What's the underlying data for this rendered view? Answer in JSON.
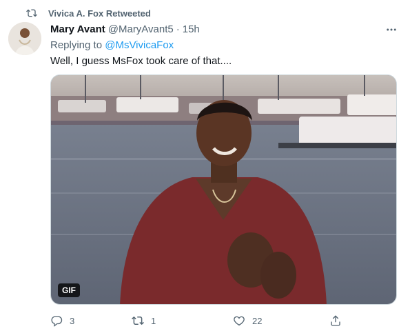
{
  "retweet_label": "Vivica A. Fox Retweeted",
  "tweet": {
    "display_name": "Mary Avant",
    "handle": "@MaryAvant5",
    "separator": "·",
    "time": "15h",
    "replying_prefix": "Replying to",
    "replying_to": "@MsVivicaFox",
    "text": "Well, I guess MsFox took care of that....",
    "media_badge": "GIF"
  },
  "actions": {
    "reply_count": "3",
    "retweet_count": "1",
    "like_count": "22"
  },
  "icons": {
    "retweet": "retweet-icon",
    "more": "more-icon",
    "reply": "reply-icon",
    "like": "heart-icon",
    "share": "share-icon"
  },
  "colors": {
    "link": "#1d9bf0",
    "secondary_text": "#536471",
    "primary_text": "#0f1419"
  }
}
